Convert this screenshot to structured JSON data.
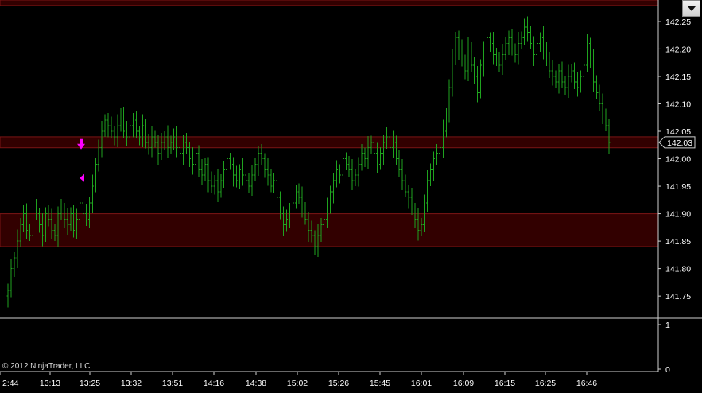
{
  "copyright": "© 2012 NinjaTrader, LLC",
  "price_marker": "142.03",
  "chart_data": [
    {
      "type": "bar",
      "style": "OHLC price bars (green)",
      "x_tick_labels": [
        "2:44",
        "13:13",
        "13:25",
        "13:32",
        "13:51",
        "14:16",
        "14:38",
        "15:02",
        "15:26",
        "15:45",
        "16:01",
        "16:09",
        "16:15",
        "16:25",
        "16:46"
      ],
      "y_ticks": [
        141.75,
        141.8,
        141.85,
        141.9,
        141.95,
        142.0,
        142.05,
        142.1,
        142.15,
        142.2,
        142.25
      ],
      "y_tick_labels": [
        "141.75",
        "141.80",
        "141.85",
        "141.90",
        "141.95",
        "142.00",
        "142.05",
        "142.10",
        "142.15",
        "142.20",
        "142.25"
      ],
      "ylim": [
        141.714,
        142.289
      ],
      "last_price": 142.03,
      "zones": [
        {
          "y_low": 142.279,
          "y_high": 142.289
        },
        {
          "y_low": 142.02,
          "y_high": 142.04
        },
        {
          "y_low": 141.84,
          "y_high": 141.9
        }
      ],
      "closes": [
        141.76,
        141.8,
        141.82,
        141.85,
        141.88,
        141.9,
        141.87,
        141.86,
        141.91,
        141.9,
        141.88,
        141.86,
        141.9,
        141.89,
        141.87,
        141.86,
        141.9,
        141.91,
        141.89,
        141.88,
        141.9,
        141.87,
        141.89,
        141.92,
        141.9,
        141.89,
        141.92,
        141.95,
        141.99,
        142.02,
        142.05,
        142.07,
        142.06,
        142.05,
        142.04,
        142.06,
        142.08,
        142.05,
        142.04,
        142.06,
        142.07,
        142.05,
        142.04,
        142.06,
        142.03,
        142.02,
        142.04,
        142.03,
        142.01,
        142.03,
        142.04,
        142.02,
        142.03,
        142.04,
        142.02,
        142.01,
        142.03,
        142.02,
        142.0,
        141.99,
        142.01,
        141.98,
        141.97,
        141.99,
        141.96,
        141.95,
        141.96,
        141.94,
        141.96,
        141.98,
        142.0,
        141.99,
        141.97,
        141.96,
        141.98,
        141.97,
        141.96,
        141.95,
        141.97,
        141.99,
        142.01,
        142.0,
        141.98,
        141.97,
        141.95,
        141.96,
        141.93,
        141.9,
        141.88,
        141.89,
        141.91,
        141.92,
        141.94,
        141.93,
        141.91,
        141.89,
        141.87,
        141.86,
        141.84,
        141.86,
        141.88,
        141.89,
        141.91,
        141.94,
        141.96,
        141.98,
        141.97,
        142.0,
        141.99,
        141.98,
        141.96,
        141.97,
        141.99,
        142.01,
        142.0,
        142.02,
        142.03,
        142.01,
        141.99,
        142.01,
        142.03,
        142.04,
        142.02,
        142.03,
        142.0,
        141.98,
        141.96,
        141.94,
        141.93,
        141.91,
        141.89,
        141.87,
        141.88,
        141.92,
        141.96,
        141.98,
        142.0,
        142.01,
        142.02,
        142.05,
        142.08,
        142.13,
        142.18,
        142.22,
        142.2,
        142.18,
        142.16,
        142.2,
        142.17,
        142.15,
        142.12,
        142.17,
        142.2,
        142.22,
        142.21,
        142.19,
        142.18,
        142.17,
        142.19,
        142.21,
        142.22,
        142.2,
        142.19,
        142.21,
        142.22,
        142.24,
        142.23,
        142.21,
        142.19,
        142.21,
        142.22,
        142.2,
        142.18,
        142.16,
        142.15,
        142.14,
        142.16,
        142.14,
        142.13,
        142.15,
        142.16,
        142.14,
        142.13,
        142.15,
        142.17,
        142.21,
        142.18,
        142.14,
        142.12,
        142.1,
        142.08,
        142.06,
        142.03
      ]
    },
    {
      "type": "bar",
      "style": "lower indicator panel",
      "y_ticks": [
        0,
        1
      ],
      "y_tick_labels": [
        "0",
        "1"
      ]
    }
  ]
}
